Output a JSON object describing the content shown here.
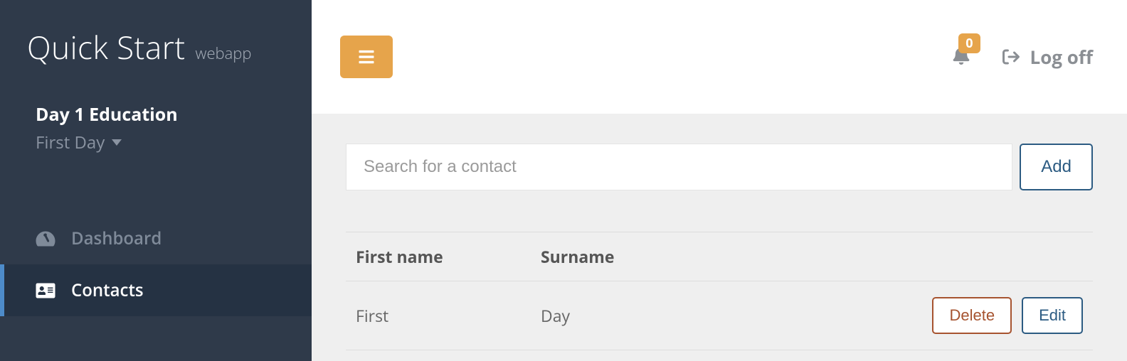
{
  "brand": {
    "main": "Quick Start",
    "sub": "webapp"
  },
  "org": {
    "title": "Day 1 Education",
    "subtitle": "First Day"
  },
  "nav": {
    "items": [
      {
        "label": "Dashboard"
      },
      {
        "label": "Contacts"
      }
    ]
  },
  "topbar": {
    "notifications_count": "0",
    "logoff_label": "Log off"
  },
  "search": {
    "placeholder": "Search for a contact",
    "add_label": "Add"
  },
  "table": {
    "headers": {
      "first": "First name",
      "surname": "Surname"
    },
    "rows": [
      {
        "first": "First",
        "surname": "Day"
      }
    ],
    "actions": {
      "delete": "Delete",
      "edit": "Edit"
    }
  }
}
